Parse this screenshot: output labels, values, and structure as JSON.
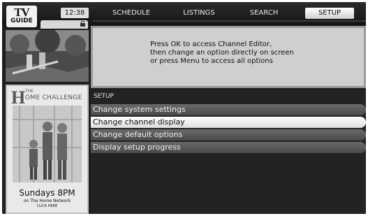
{
  "logo": {
    "line1": "TV",
    "line2": "GUIDE"
  },
  "header": {
    "time": "12:38",
    "nav": [
      {
        "label": "SCHEDULE",
        "selected": false
      },
      {
        "label": "LISTINGS",
        "selected": false
      },
      {
        "label": "SEARCH",
        "selected": false
      },
      {
        "label": "SETUP",
        "selected": true
      }
    ]
  },
  "message": {
    "lines": [
      "Press OK to access Channel Editor,",
      "then change an option directly on screen",
      "or press Menu to access all options"
    ]
  },
  "ad": {
    "the": "THE",
    "h": "H",
    "title": "OME CHALLENGE",
    "airtime": "Sundays 8PM",
    "network": "on The Home Network",
    "cta": "CLICK HERE"
  },
  "setup": {
    "header": "SETUP",
    "items": [
      {
        "label": "Change system settings",
        "selected": false
      },
      {
        "label": "Change channel display",
        "selected": true
      },
      {
        "label": "Change default options",
        "selected": false
      },
      {
        "label": "Display setup progress",
        "selected": false
      }
    ]
  },
  "icons": {
    "lock": "lock-icon"
  }
}
